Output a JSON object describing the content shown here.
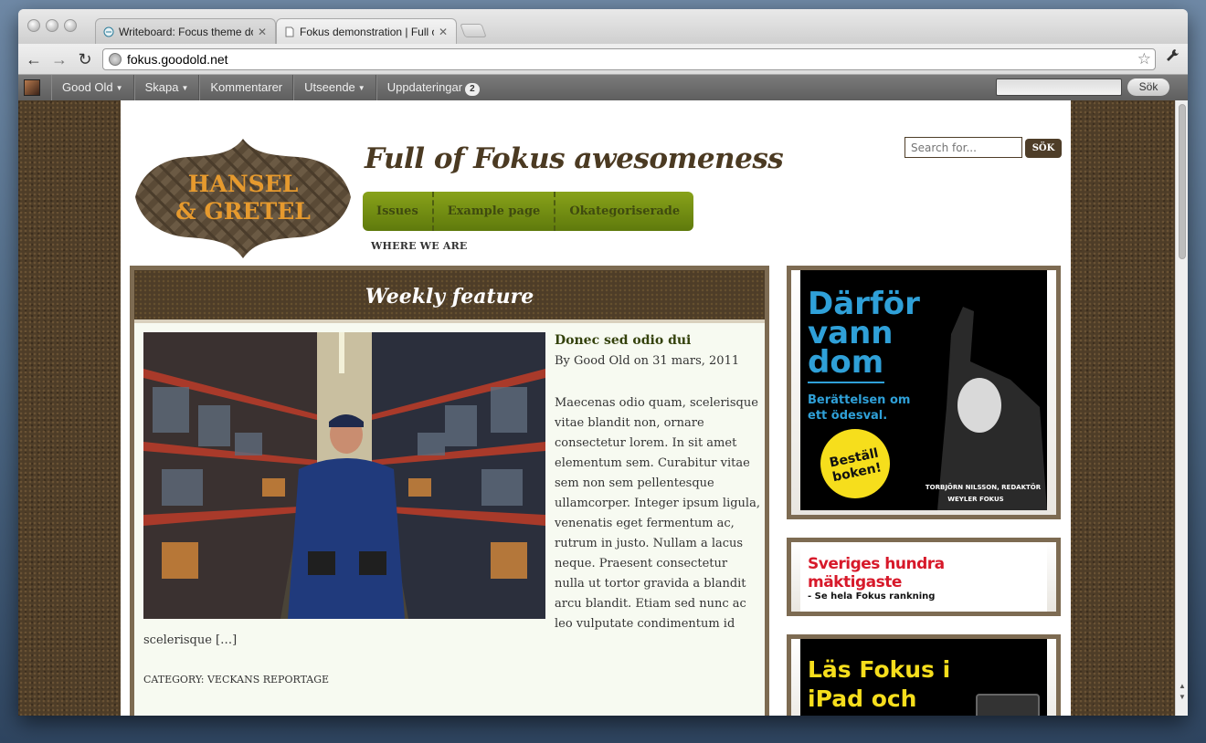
{
  "browser": {
    "tabs": [
      {
        "title": "Writeboard: Focus theme doc",
        "active": false
      },
      {
        "title": "Fokus demonstration | Full o",
        "active": true
      }
    ],
    "url": "fokus.goodold.net"
  },
  "adminbar": {
    "items": [
      {
        "label": "Good Old",
        "dropdown": true
      },
      {
        "label": "Skapa",
        "dropdown": true
      },
      {
        "label": "Kommentarer",
        "dropdown": false
      },
      {
        "label": "Utseende",
        "dropdown": true
      },
      {
        "label": "Uppdateringar",
        "dropdown": false
      }
    ],
    "updates_count": "2",
    "search_button": "Sök"
  },
  "site": {
    "logo_line1": "HANSEL",
    "logo_line2": "& GRETEL",
    "title": "Full of Fokus awesomeness",
    "nav": [
      "Issues",
      "Example page",
      "Okategoriserade"
    ],
    "subnav": "WHERE WE ARE",
    "search_placeholder": "Search for...",
    "search_button": "SÖK"
  },
  "feature": {
    "heading": "Weekly feature",
    "post_title": "Donec sed odio dui",
    "byline": "By Good Old on 31 mars, 2011",
    "excerpt": "Maecenas odio quam, scelerisque vitae blandit non, ornare consectetur lorem. In sit amet elementum sem. Curabitur vitae sem non sem pellentesque ullamcorper. Integer ipsum ligula, venenatis eget fermentum ac, rutrum in justo. Nullam a lacus neque. Praesent consectetur nulla ut tortor gravida a blandit arcu blandit. Etiam sed nunc ac leo vulputate condimentum id",
    "excerpt_end": "scelerisque […]",
    "category": "CATEGORY: VECKANS REPORTAGE"
  },
  "ads": {
    "ad1_headline": [
      "Därför",
      "vann",
      "dom"
    ],
    "ad1_sub": [
      "Berättelsen om",
      "ett ödesval."
    ],
    "ad1_badge": [
      "Beställ",
      "boken!"
    ],
    "ad1_credit": "TORBJÖRN NILSSON, REDAKTÖR",
    "ad1_publisher": "WEYLER  FOKUS",
    "ad2_headline": "Sveriges hundra mäktigaste",
    "ad2_sub": "- Se hela Fokus rankning",
    "ad3_headline": [
      "Läs Fokus i",
      "iPad och"
    ]
  }
}
